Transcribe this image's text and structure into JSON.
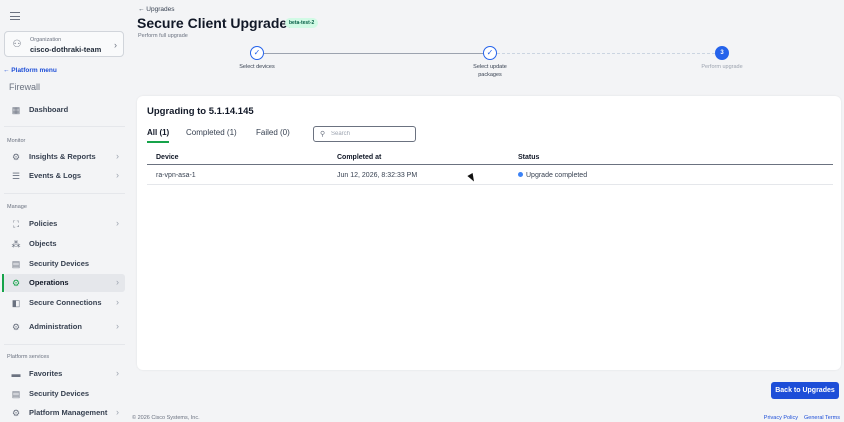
{
  "sidebar": {
    "org_label": "Organization",
    "org_name": "cisco-dothraki-team",
    "platform_menu": "← Platform menu",
    "section_title": "Firewall",
    "dashboard": "Dashboard",
    "monitor_label": "Monitor",
    "insights": "Insights & Reports",
    "events": "Events & Logs",
    "manage_label": "Manage",
    "policies": "Policies",
    "objects": "Objects",
    "security_devices": "Security Devices",
    "operations": "Operations",
    "secure_connections": "Secure Connections",
    "administration": "Administration",
    "platform_services_label": "Platform services",
    "favorites": "Favorites",
    "ps_security_devices": "Security Devices",
    "platform_management": "Platform Management"
  },
  "header": {
    "back": "← Upgrades",
    "title": "Secure Client Upgrades",
    "badge": "beta-test-2",
    "subtitle": "Perform full upgrade"
  },
  "stepper": {
    "step1": "Select devices",
    "step2_line1": "Select update",
    "step2_line2": "packages",
    "step3": "Perform upgrade",
    "step3_number": "3"
  },
  "card": {
    "title": "Upgrading to 5.1.14.145",
    "tabs": [
      "All (1)",
      "Completed (1)",
      "Failed (0)"
    ],
    "search_placeholder": "Search",
    "columns": [
      "Device",
      "Completed at",
      "Status"
    ],
    "rows": [
      {
        "device": "ra-vpn-asa-1",
        "completed_at": "Jun 12, 2026, 8:32:33 PM",
        "status": "Upgrade completed"
      }
    ]
  },
  "actions": {
    "back_to_upgrades": "Back to Upgrades"
  },
  "footer": {
    "copyright": "© 2026 Cisco Systems, Inc.",
    "privacy": "Privacy Policy",
    "terms": "General Terms"
  },
  "colors": {
    "accent_green": "#16a34a",
    "primary_blue": "#1d4ed8",
    "status_blue": "#3b82f6"
  }
}
